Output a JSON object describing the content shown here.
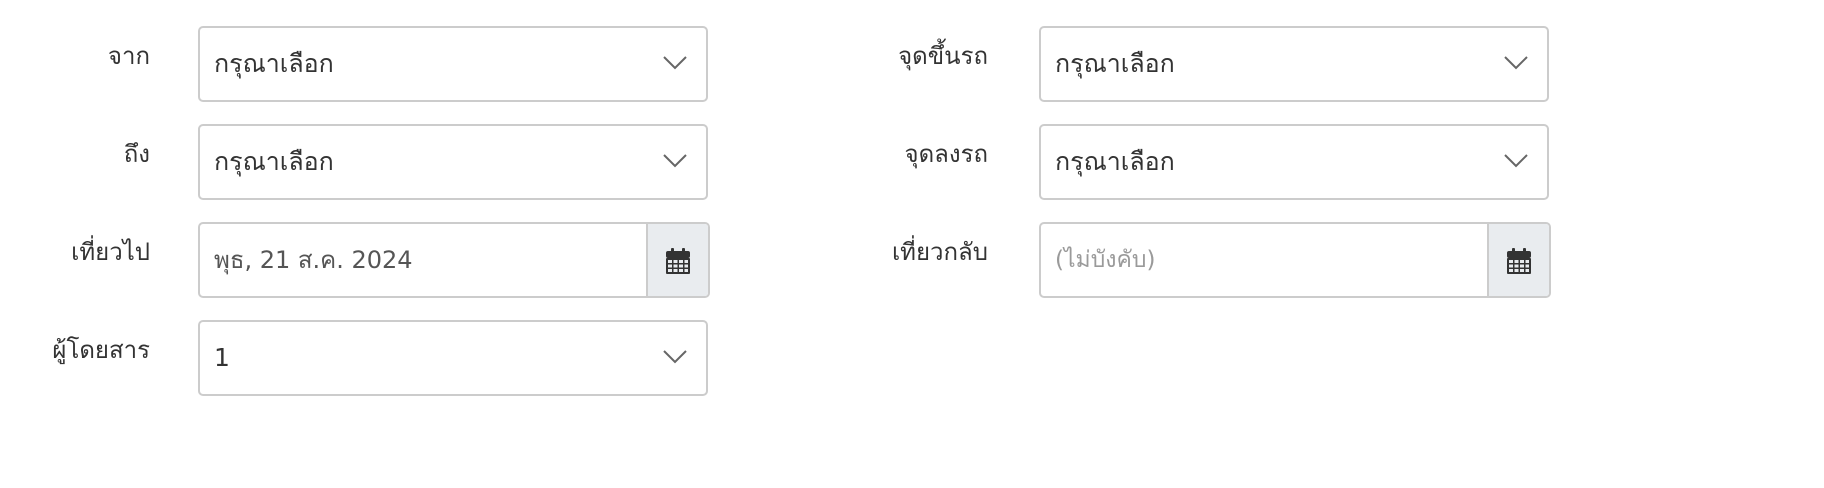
{
  "form": {
    "from": {
      "label": "จาก",
      "value": "กรุณาเลือก"
    },
    "to": {
      "label": "ถึง",
      "value": "กรุณาเลือก"
    },
    "departure": {
      "label": "เที่ยวไป",
      "value": "พุธ, 21 ส.ค. 2024"
    },
    "passengers": {
      "label": "ผู้โดยสาร",
      "value": "1"
    },
    "pickup": {
      "label": "จุดขึ้นรถ",
      "value": "กรุณาเลือก"
    },
    "dropoff": {
      "label": "จุดลงรถ",
      "value": "กรุณาเลือก"
    },
    "return": {
      "label": "เที่ยวกลับ",
      "placeholder": "(ไม่บังคับ)"
    }
  },
  "icons": {
    "dropdown": "chevron-down-icon",
    "calendar": "calendar-icon"
  },
  "colors": {
    "border": "#cccccc",
    "addon_bg": "#e9ecef",
    "text": "#333333",
    "placeholder": "#9a9a9a"
  }
}
